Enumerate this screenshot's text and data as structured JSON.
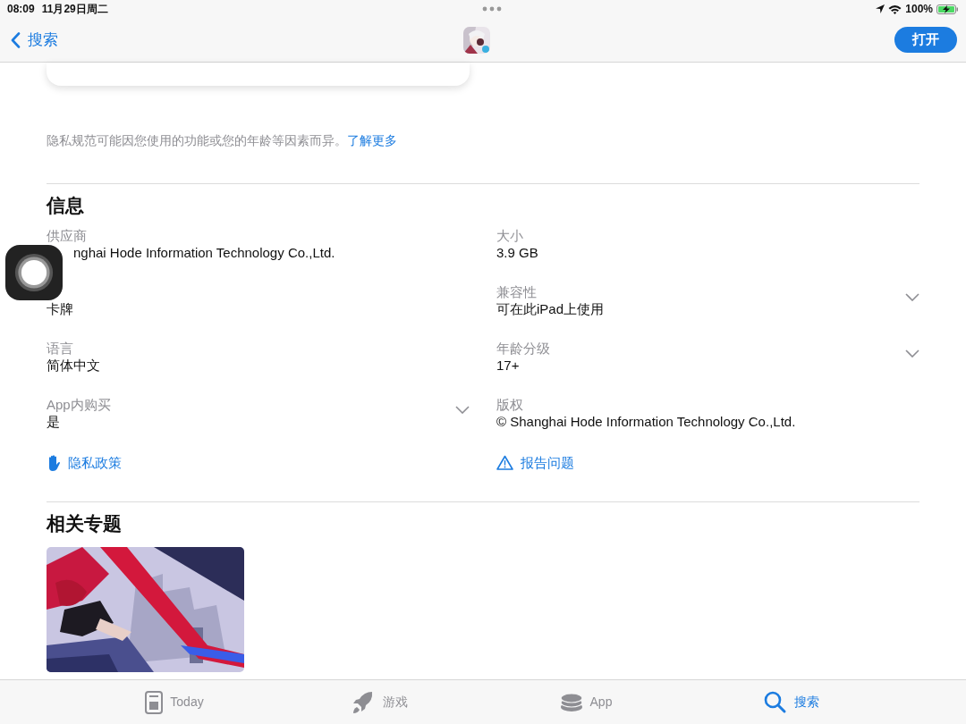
{
  "status_bar": {
    "time": "08:09",
    "date": "11月29日周二",
    "battery": "100%",
    "charging": true
  },
  "nav_bar": {
    "back": "搜索",
    "open_button": "打开"
  },
  "privacy_note": {
    "text": "隐私规范可能因您使用的功能或您的年龄等因素而异。",
    "link": "了解更多"
  },
  "info": {
    "title": "信息",
    "left_column": [
      {
        "label": "供应商",
        "value": "nghai Hode Information Technology Co.,Ltd.",
        "expandable": false
      },
      {
        "value": "卡牌",
        "expandable": false
      },
      {
        "label": "语言",
        "value": "简体中文",
        "expandable": false
      },
      {
        "label": "App内购买",
        "value": "是",
        "expandable": true
      }
    ],
    "right_column": [
      {
        "label": "大小",
        "value": "3.9 GB",
        "expandable": false
      },
      {
        "label": "兼容性",
        "value": "可在此iPad上使用",
        "expandable": true
      },
      {
        "label": "年龄分级",
        "value": "17+",
        "expandable": true
      },
      {
        "label": "版权",
        "value": "© Shanghai Hode Information Technology Co.,Ltd.",
        "expandable": false
      }
    ],
    "links": [
      {
        "kind": "hand",
        "label": "隐私政策"
      },
      {
        "kind": "warning",
        "label": "报告问题"
      }
    ]
  },
  "related": {
    "title": "相关专题"
  },
  "tab_bar": [
    {
      "kind": "today",
      "label": "Today",
      "selected": false
    },
    {
      "kind": "games",
      "label": "游戏",
      "selected": false
    },
    {
      "kind": "apps",
      "label": "App",
      "selected": false
    },
    {
      "kind": "search",
      "label": "搜索",
      "selected": true
    }
  ]
}
